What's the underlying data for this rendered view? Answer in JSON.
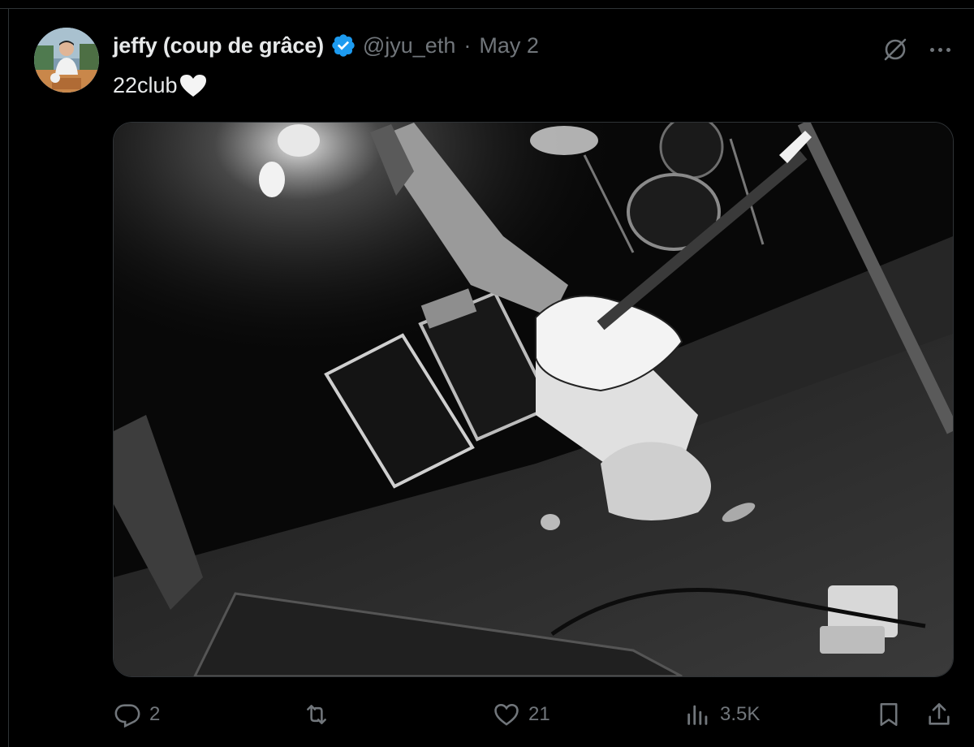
{
  "tweet": {
    "author_name": "jeffy (coup de grâce)",
    "handle": "@jyu_eth",
    "separator": "·",
    "date": "May 2",
    "text": "22club"
  },
  "actions": {
    "reply_count": "2",
    "retweet_count": "",
    "like_count": "21",
    "views_count": "3.5K"
  },
  "colors": {
    "background": "#000000",
    "primary_text": "#e7e9ea",
    "secondary_text": "#71767b",
    "verified_badge": "#1d9bf0",
    "border": "#2f3336"
  },
  "icons": {
    "verified": "verified-badge-icon",
    "grok": "grok-icon",
    "more": "more-icon",
    "reply": "reply-icon",
    "retweet": "retweet-icon",
    "like": "heart-icon",
    "views": "views-icon",
    "bookmark": "bookmark-icon",
    "share": "share-icon"
  }
}
